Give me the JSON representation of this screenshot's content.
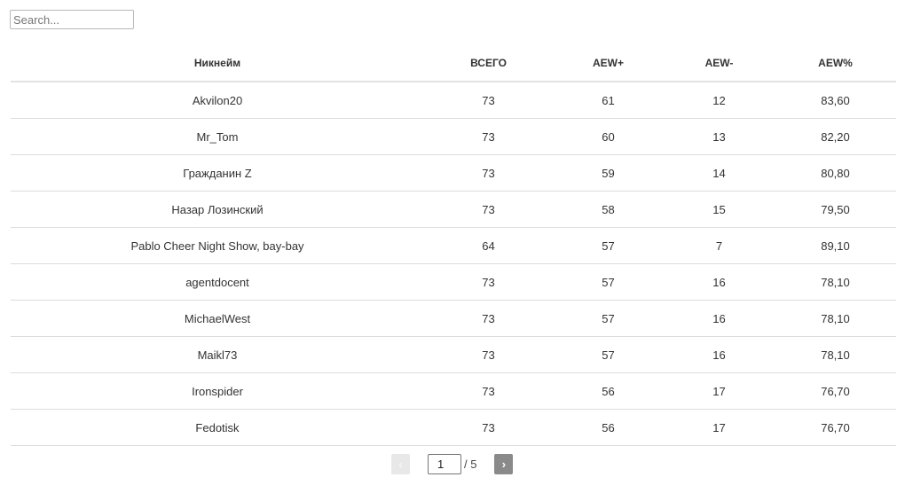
{
  "search": {
    "placeholder": "Search...",
    "value": ""
  },
  "table": {
    "columns": [
      "Никнейм",
      "ВСЕГО",
      "AEW+",
      "AEW-",
      "AEW%"
    ],
    "rows": [
      [
        "Akvilon20",
        "73",
        "61",
        "12",
        "83,60"
      ],
      [
        "Mr_Tom",
        "73",
        "60",
        "13",
        "82,20"
      ],
      [
        "Гражданин Z",
        "73",
        "59",
        "14",
        "80,80"
      ],
      [
        "Назар Лозинский",
        "73",
        "58",
        "15",
        "79,50"
      ],
      [
        "Pablo Cheer Night Show, bay-bay",
        "64",
        "57",
        "7",
        "89,10"
      ],
      [
        "agentdocent",
        "73",
        "57",
        "16",
        "78,10"
      ],
      [
        "MichaelWest",
        "73",
        "57",
        "16",
        "78,10"
      ],
      [
        "Maikl73",
        "73",
        "57",
        "16",
        "78,10"
      ],
      [
        "Ironspider",
        "73",
        "56",
        "17",
        "76,70"
      ],
      [
        "Fedotisk",
        "73",
        "56",
        "17",
        "76,70"
      ]
    ]
  },
  "pagination": {
    "prev_label": "‹",
    "next_label": "›",
    "current_page": "1",
    "total_label": "/ 5",
    "prev_icon": "chevron-left-icon",
    "next_icon": "chevron-right-icon"
  }
}
